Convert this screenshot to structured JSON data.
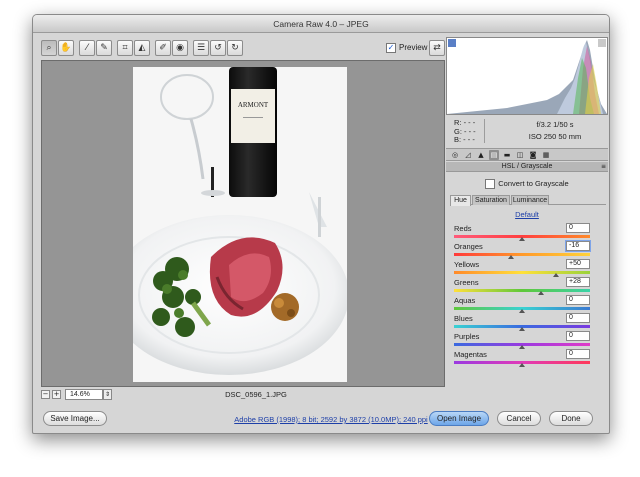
{
  "window": {
    "title": "Camera Raw 4.0  –  JPEG"
  },
  "toolbar": {
    "tools": [
      "zoom-icon",
      "hand-icon",
      "white-balance-icon",
      "color-sampler-icon",
      "crop-icon",
      "straighten-icon",
      "retouch-icon",
      "red-eye-icon",
      "preferences-icon",
      "rotate-left-icon",
      "rotate-right-icon"
    ],
    "preview_label": "Preview",
    "preview_checked": "✓"
  },
  "status": {
    "zoom": "14.6%",
    "filename": "DSC_0596_1.JPG"
  },
  "readout": {
    "r": "R:  - - -",
    "g": "G:  - - -",
    "b": "B:  - - -",
    "aperture_shutter": "f/3.2    1/50 s",
    "iso_focal": "ISO 250    50 mm"
  },
  "panel": {
    "header": "HSL / Grayscale",
    "menu_glyph": "≡",
    "grayscale_label": "Convert to Grayscale",
    "tabs": [
      "Hue",
      "Saturation",
      "Luminance"
    ],
    "selected_tab": "Hue",
    "default_label": "Default",
    "sliders": [
      {
        "label": "Reds",
        "value": "0",
        "amount": 0
      },
      {
        "label": "Oranges",
        "value": "-16",
        "amount": -16
      },
      {
        "label": "Yellows",
        "value": "+50",
        "amount": 50
      },
      {
        "label": "Greens",
        "value": "+28",
        "amount": 28
      },
      {
        "label": "Aquas",
        "value": "0",
        "amount": 0
      },
      {
        "label": "Blues",
        "value": "0",
        "amount": 0
      },
      {
        "label": "Purples",
        "value": "0",
        "amount": 0
      },
      {
        "label": "Magentas",
        "value": "0",
        "amount": 0
      }
    ]
  },
  "buttons": {
    "save": "Save Image...",
    "info": "Adobe RGB (1998); 8 bit; 2592 by 3872 (10.0MP); 240 ppi",
    "open": "Open Image",
    "cancel": "Cancel",
    "done": "Done"
  },
  "colors": {
    "accent": "#6ca5e8",
    "link": "#1d3fa8"
  }
}
